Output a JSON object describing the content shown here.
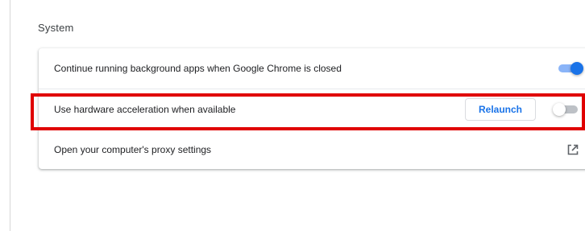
{
  "section": {
    "title": "System"
  },
  "settings": {
    "rows": [
      {
        "label": "Continue running background apps when Google Chrome is closed",
        "control": "toggle",
        "enabled": true
      },
      {
        "label": "Use hardware acceleration when available",
        "control": "toggle",
        "enabled": false,
        "action_label": "Relaunch"
      },
      {
        "label": "Open your computer's proxy settings",
        "control": "external-link",
        "icon": "external-link-icon"
      }
    ]
  },
  "colors": {
    "accent": "#1a73e8",
    "toggle_on_track": "#8ab4f8",
    "toggle_off_track": "#bdc1c6",
    "highlight": "#e00000",
    "text": "#202124"
  }
}
